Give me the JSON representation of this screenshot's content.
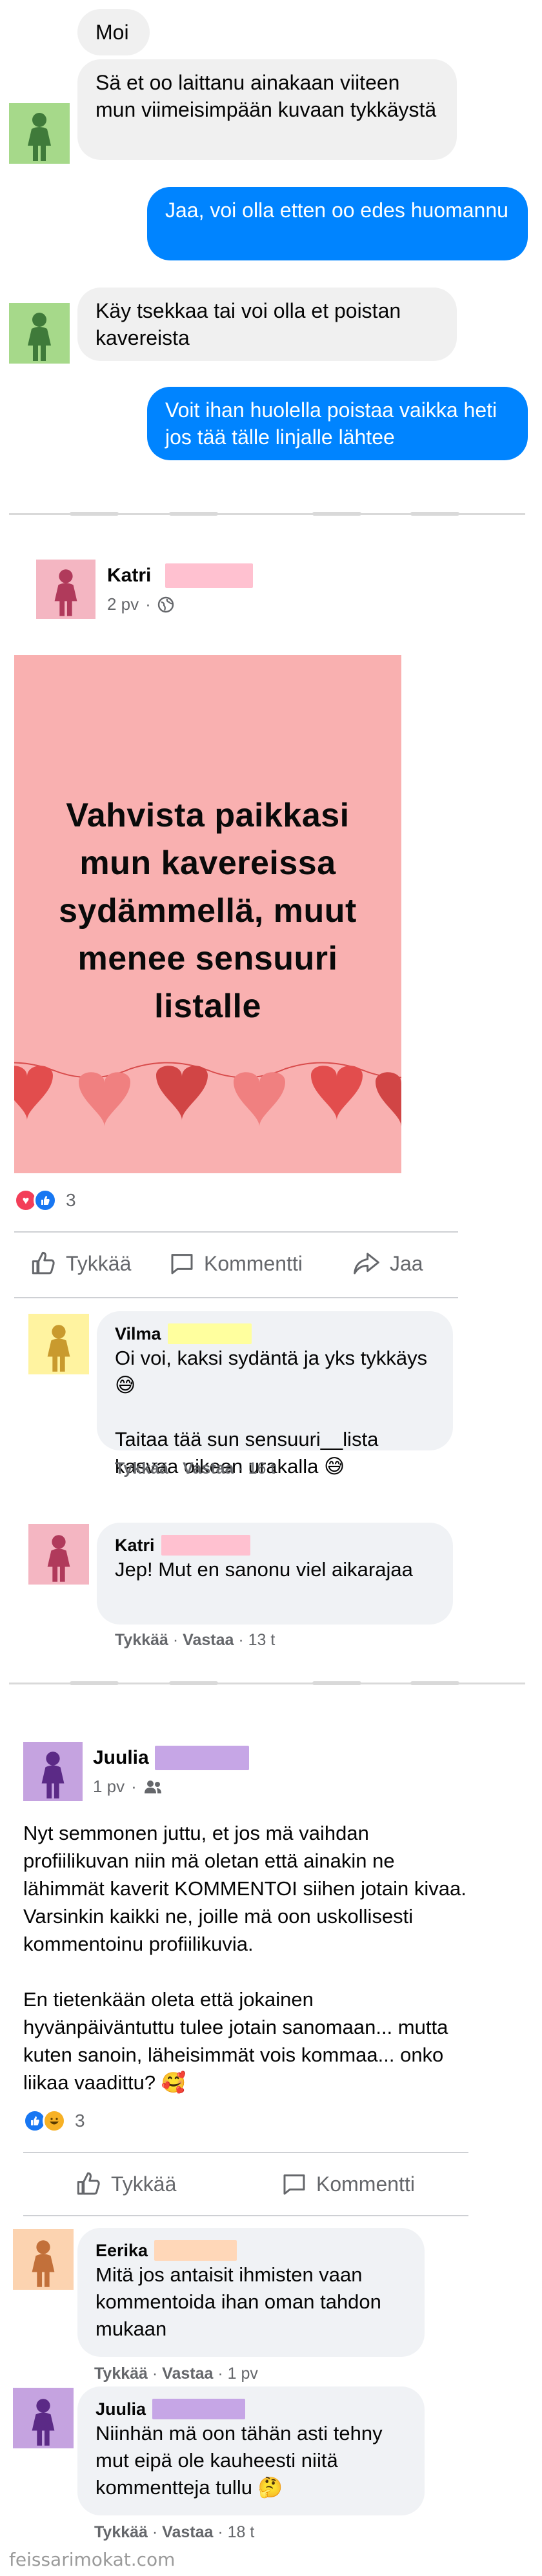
{
  "chat": {
    "messages": [
      {
        "from": "them",
        "text": "Moi"
      },
      {
        "from": "them",
        "text": "Sä et oo laittanu ainakaan viiteen mun viimeisimpään kuvaan tykkäystä"
      },
      {
        "from": "me",
        "text": "Jaa, voi olla etten oo edes huomannu"
      },
      {
        "from": "them",
        "text": "Käy tsekkaa tai voi olla et poistan kavereista"
      },
      {
        "from": "me",
        "text": "Voit ihan huolella poistaa vaikka heti jos tää tälle linjalle lähtee"
      }
    ]
  },
  "post1": {
    "author": "Katri",
    "time": "2 pv",
    "image_text": "Vahvista paikkasi mun kavereissa sydämmellä, muut menee sensuuri listalle",
    "reaction_count": "3",
    "actions": {
      "like": "Tykkää",
      "comment": "Kommentti",
      "share": "Jaa"
    },
    "comments": [
      {
        "author": "Vilma",
        "text": "Oi voi, kaksi sydäntä ja yks tykkäys 😅\n\nTaitaa tää sun sensuuri__lista kasvaa oikeen urakalla 😅",
        "like": "Tykkää",
        "reply": "Vastaa",
        "time": "16 t"
      },
      {
        "author": "Katri",
        "text": "Jep! Mut en sanonu viel aikarajaa",
        "like": "Tykkää",
        "reply": "Vastaa",
        "time": "13 t"
      }
    ]
  },
  "post2": {
    "author": "Juulia",
    "time": "1 pv",
    "text_p1": "Nyt semmonen juttu, et jos mä vaihdan profiilikuvan niin mä oletan että ainakin ne lähimmät kaverit KOMMENTOI siihen jotain kivaa. Varsinkin kaikki ne, joille mä oon uskollisesti kommentoinu profiilikuvia.",
    "text_p2": "En tietenkään oleta että jokainen hyvänpäiväntuttu tulee jotain sanomaan... mutta kuten sanoin, läheisimmät vois kommaa... onko liikaa vaadittu? 🥰",
    "reaction_count": "3",
    "actions": {
      "like": "Tykkää",
      "comment": "Kommentti"
    },
    "comments": [
      {
        "author": "Eerika",
        "text": "Mitä jos antaisit ihmisten vaan kommentoida ihan oman tahdon mukaan",
        "like": "Tykkää",
        "reply": "Vastaa",
        "time": "1 pv"
      },
      {
        "author": "Juulia",
        "text": "Niinhän mä oon tähän asti tehny mut eipä ole kauheesti niitä kommentteja tullu 🤔",
        "like": "Tykkää",
        "reply": "Vastaa",
        "time": "18 t"
      }
    ]
  },
  "watermark": "feissarimokat.com",
  "colors": {
    "messenger_blue": "#0084ff",
    "green_avatar": "#a6d98a",
    "pink_avatar": "#f4b6c2",
    "yellow_avatar": "#fff3a0",
    "purple_avatar": "#c5a3e0",
    "peach_avatar": "#fcd3b0",
    "post_image_bg": "#f9b0b0"
  }
}
